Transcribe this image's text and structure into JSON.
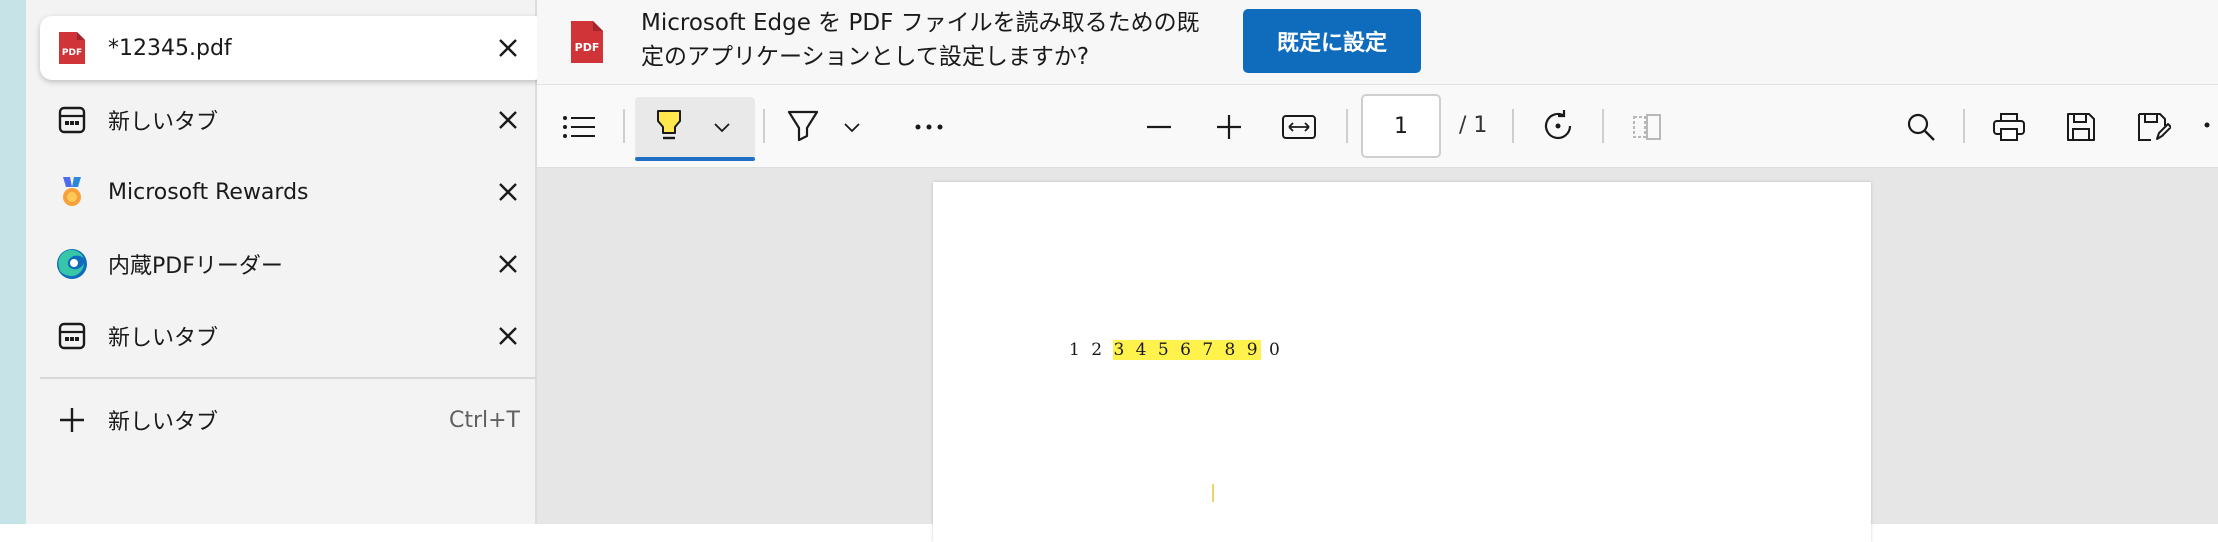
{
  "tabs": [
    {
      "title": "*12345.pdf",
      "favicon": "pdf-icon",
      "active": true
    },
    {
      "title": "新しいタブ",
      "favicon": "new-tab-page-icon",
      "active": false
    },
    {
      "title": "Microsoft Rewards",
      "favicon": "rewards-medal-icon",
      "active": false
    },
    {
      "title": "内蔵PDFリーダー",
      "favicon": "edge-logo-icon",
      "active": false
    },
    {
      "title": "新しいタブ",
      "favicon": "new-tab-page-icon",
      "active": false
    }
  ],
  "new_tab": {
    "label": "新しいタブ",
    "shortcut": "Ctrl+T"
  },
  "infobar": {
    "message": "Microsoft Edge を PDF ファイルを読み取るための既定のアプリケーションとして設定しますか?",
    "button_label": "既定に設定"
  },
  "toolbar": {
    "current_page": "1",
    "total_pages": "/ 1",
    "icons": [
      "contents-icon",
      "highlight-icon",
      "chevron-down-icon",
      "draw-icon",
      "chevron-down-icon",
      "more-icon",
      "zoom-out-icon",
      "zoom-in-icon",
      "fit-width-icon",
      "rotate-icon",
      "page-view-icon",
      "search-icon",
      "print-icon",
      "save-icon",
      "save-as-icon"
    ]
  },
  "document": {
    "text_before": "1 2 ",
    "text_highlighted": "3 4 5 6 7 8 9",
    "text_after": " 0"
  },
  "colors": {
    "accent": "#0f6cbd",
    "highlight": "#fff24d",
    "sidebar_strip": "#c6e4e7"
  }
}
